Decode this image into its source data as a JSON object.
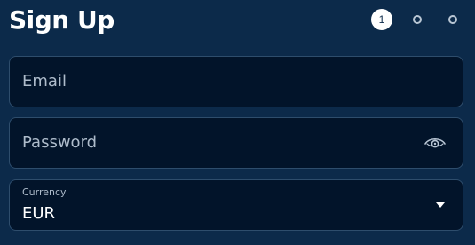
{
  "header": {
    "title": "Sign Up",
    "steps": [
      {
        "label": "1",
        "state": "active"
      },
      {
        "label": "",
        "state": "pending"
      },
      {
        "label": "",
        "state": "pending"
      }
    ]
  },
  "form": {
    "email": {
      "placeholder": "Email",
      "value": ""
    },
    "password": {
      "placeholder": "Password",
      "value": "",
      "toggle_icon": "eye-icon"
    },
    "currency": {
      "label": "Currency",
      "value": "EUR",
      "dropdown_icon": "caret-down-icon"
    }
  },
  "colors": {
    "background": "#0c2a4a",
    "field_background": "#02142a",
    "field_border": "#2e4d6c",
    "placeholder_text": "#aebccb",
    "text": "#ffffff"
  }
}
